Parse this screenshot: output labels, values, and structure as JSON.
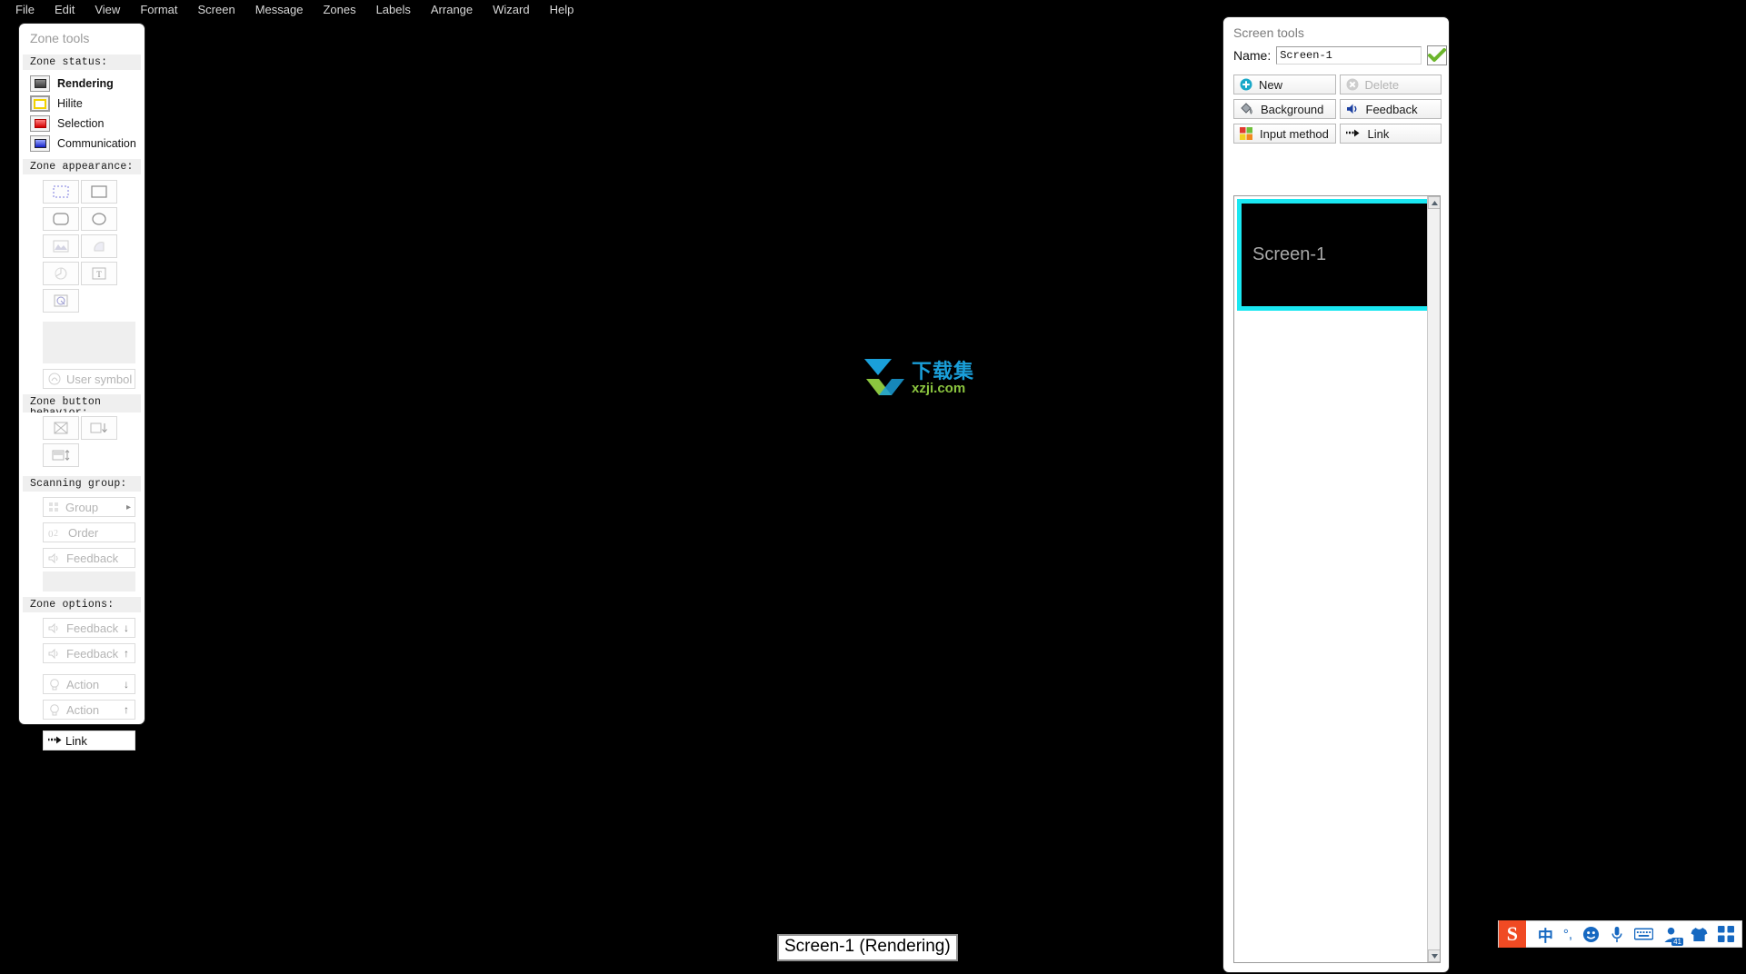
{
  "menubar": {
    "items": [
      {
        "label": "File"
      },
      {
        "label": "Edit"
      },
      {
        "label": "View"
      },
      {
        "label": "Format"
      },
      {
        "label": "Screen"
      },
      {
        "label": "Message"
      },
      {
        "label": "Zones"
      },
      {
        "label": "Labels"
      },
      {
        "label": "Arrange"
      },
      {
        "label": "Wizard"
      },
      {
        "label": "Help"
      }
    ]
  },
  "zone_tools": {
    "title": "Zone tools",
    "sections": {
      "zone_status": {
        "label": "Zone status:",
        "items": [
          {
            "label": "Rendering",
            "icon": "rendering-swatch-icon",
            "active": true
          },
          {
            "label": "Hilite",
            "icon": "hilite-swatch-icon",
            "active": false
          },
          {
            "label": "Selection",
            "icon": "selection-swatch-icon",
            "active": false
          },
          {
            "label": "Communication",
            "icon": "communication-swatch-icon",
            "active": false
          }
        ]
      },
      "zone_appearance": {
        "label": "Zone appearance:",
        "buttons": [
          {
            "icon": "dashed-rectangle-icon"
          },
          {
            "icon": "solid-rectangle-icon"
          },
          {
            "icon": "rounded-rectangle-icon"
          },
          {
            "icon": "ellipse-icon"
          },
          {
            "icon": "image-icon"
          },
          {
            "icon": "shaded-corner-icon"
          },
          {
            "icon": "pie-shape-icon"
          },
          {
            "icon": "text-zone-icon"
          },
          {
            "icon": "image-zone-icon"
          }
        ],
        "user_symbol_label": "User symbol",
        "user_symbol_icon": "user-symbol-icon"
      },
      "zone_button": {
        "label": "Zone button",
        "label_line2": "behavior:",
        "buttons": [
          {
            "icon": "cross-box-icon"
          },
          {
            "icon": "box-down-arrow-icon"
          },
          {
            "icon": "box-updown-arrow-icon"
          }
        ]
      },
      "scanning_group": {
        "label": "Scanning group:",
        "items": [
          {
            "label": "Group",
            "icon": "group-grid-icon",
            "has_submenu": true
          },
          {
            "label": "Order",
            "icon": "order-number-icon",
            "has_submenu": false
          },
          {
            "label": "Feedback",
            "icon": "speaker-icon",
            "has_submenu": false
          }
        ]
      },
      "zone_options": {
        "label": "Zone options:",
        "items": [
          {
            "label": "Feedback",
            "icon": "speaker-icon",
            "arrow": "↓"
          },
          {
            "label": "Feedback",
            "icon": "speaker-icon",
            "arrow": "↑"
          },
          {
            "label": "Action",
            "icon": "lightbulb-icon",
            "arrow": "↓"
          },
          {
            "label": "Action",
            "icon": "lightbulb-icon",
            "arrow": "↑"
          },
          {
            "label": "Link",
            "icon": "link-arrow-icon",
            "arrow": ""
          }
        ]
      }
    }
  },
  "screen_tools": {
    "title": "Screen tools",
    "name_label": "Name:",
    "name_value": "Screen-1",
    "confirm_icon": "green-check-icon",
    "buttons": [
      {
        "label": "New",
        "icon": "plus-circle-icon",
        "disabled": false
      },
      {
        "label": "Delete",
        "icon": "close-circle-icon",
        "disabled": true
      },
      {
        "label": "Background",
        "icon": "paint-bucket-icon",
        "disabled": false
      },
      {
        "label": "Feedback",
        "icon": "speaker-icon",
        "disabled": false
      },
      {
        "label": "Input method",
        "icon": "color-squares-icon",
        "disabled": false
      },
      {
        "label": "Link",
        "icon": "link-arrow-icon",
        "disabled": false
      }
    ],
    "thumbnails": [
      {
        "label": "Screen-1",
        "selected": true
      }
    ],
    "scroll_up_icon": "scroll-up-icon",
    "scroll_down_icon": "scroll-down-icon"
  },
  "canvas": {
    "status_label": "Screen-1 (Rendering)",
    "watermark": {
      "cn": "下载集",
      "en": "xzji.com",
      "icon": "download-arrow-icon"
    }
  },
  "tray": {
    "items": [
      {
        "icon": "sogou-logo-icon",
        "label": "S"
      },
      {
        "icon": "chinese-mode-icon",
        "label": "中"
      },
      {
        "icon": "punctuation-icon",
        "label": "°,"
      },
      {
        "icon": "emoji-icon",
        "label": ""
      },
      {
        "icon": "microphone-icon",
        "label": ""
      },
      {
        "icon": "keyboard-icon",
        "label": ""
      },
      {
        "icon": "user-icon",
        "label": "",
        "badge": "41"
      },
      {
        "icon": "shirt-icon",
        "label": ""
      },
      {
        "icon": "app-grid-icon",
        "label": ""
      }
    ]
  },
  "colors": {
    "accent_cyan": "#1ae7f1",
    "tray_blue": "#1668c1",
    "watermark_blue": "#1a9fd9",
    "watermark_green": "#8bc53f",
    "sogou_orange": "#f04a23"
  }
}
